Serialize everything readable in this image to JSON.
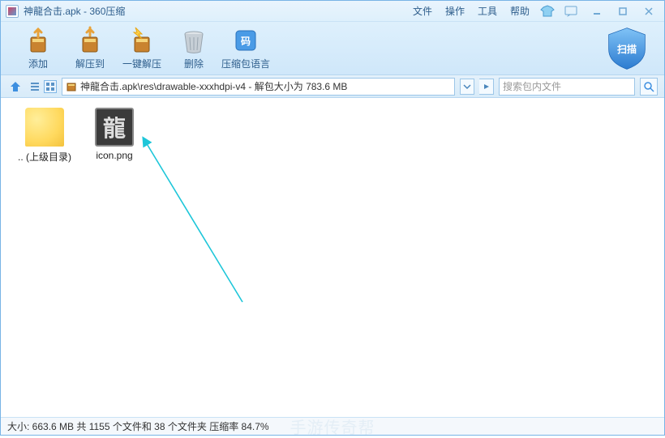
{
  "window": {
    "title": "神龍合击.apk - 360压缩"
  },
  "menu": {
    "file": "文件",
    "operation": "操作",
    "tools": "工具",
    "help": "帮助"
  },
  "toolbar": {
    "add": "添加",
    "extract_to": "解压到",
    "one_click_extract": "一键解压",
    "delete": "删除",
    "archive_lang": "压缩包语言"
  },
  "scan": {
    "label": "扫描"
  },
  "path": {
    "value": "神龍合击.apk\\res\\drawable-xxxhdpi-v4 - 解包大小为 783.6 MB"
  },
  "search": {
    "placeholder": "搜索包内文件"
  },
  "files": {
    "up_dir": ".. (上级目录)",
    "icon_png": "icon.png"
  },
  "status": {
    "text": "大小: 663.6 MB 共 1155 个文件和 38 个文件夹 压缩率 84.7%"
  },
  "watermark": "手游传奇帮"
}
